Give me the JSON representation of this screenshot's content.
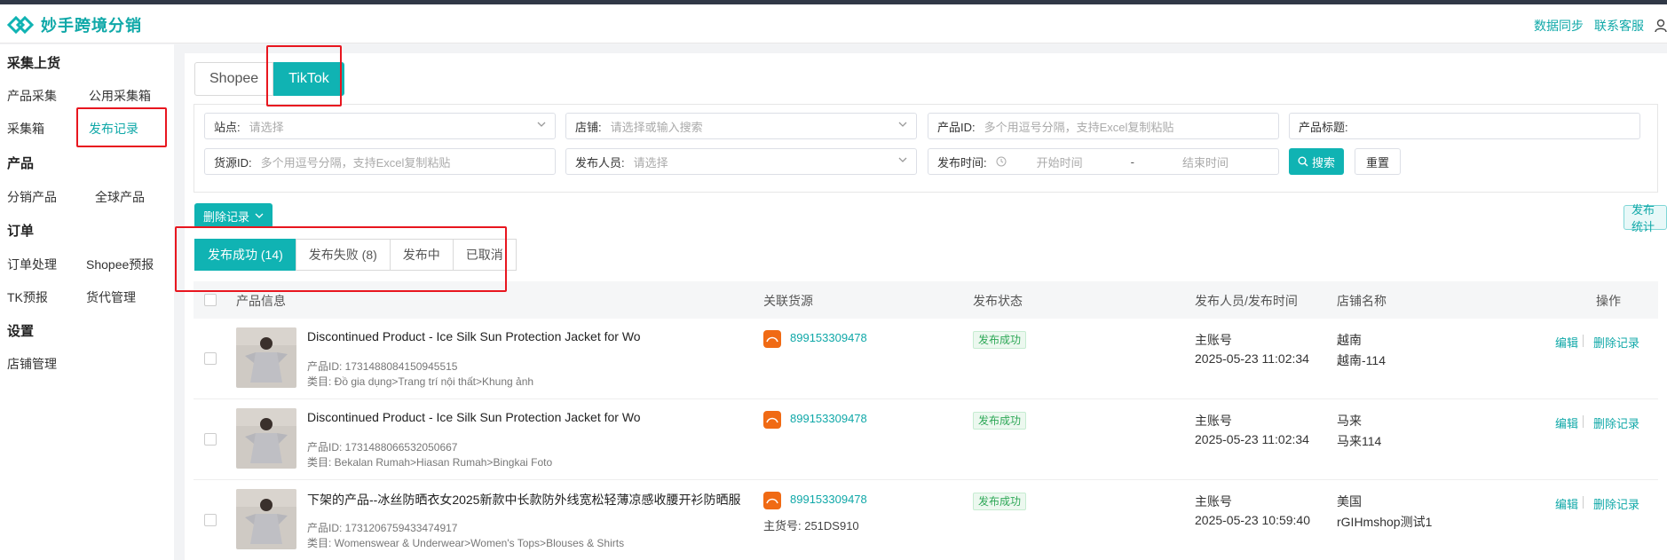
{
  "app": {
    "title": "妙手跨境分销"
  },
  "header": {
    "links": [
      "数据同步",
      "联系客服"
    ]
  },
  "sidebar": {
    "groups": [
      {
        "title": "采集上货",
        "items": [
          "产品采集",
          "公用采集箱",
          "采集箱",
          "发布记录"
        ]
      },
      {
        "title": "产品",
        "items": [
          "分销产品",
          "全球产品"
        ]
      },
      {
        "title": "订单",
        "items": [
          "订单处理",
          "Shopee预报",
          "TK预报",
          "货代管理"
        ]
      },
      {
        "title": "设置",
        "items": [
          "店铺管理"
        ]
      }
    ]
  },
  "platform_tabs": [
    "Shopee",
    "TikTok"
  ],
  "filters": {
    "site": {
      "label": "站点:",
      "placeholder": "请选择"
    },
    "store": {
      "label": "店铺:",
      "placeholder": "请选择或输入搜索"
    },
    "product_id": {
      "label": "产品ID:",
      "placeholder": "多个用逗号分隔，支持Excel复制粘贴"
    },
    "product_title": {
      "label": "产品标题:",
      "placeholder": ""
    },
    "source_id": {
      "label": "货源ID:",
      "placeholder": "多个用逗号分隔，支持Excel复制粘贴"
    },
    "publisher": {
      "label": "发布人员:",
      "placeholder": "请选择"
    },
    "publish_time": {
      "label": "发布时间:",
      "start": "开始时间",
      "sep": "-",
      "end": "结束时间"
    },
    "search_label": "搜索",
    "reset_label": "重置"
  },
  "toolbar": {
    "delete_label": "删除记录",
    "stats_label": "发布统计"
  },
  "status_tabs": [
    "发布成功 (14)",
    "发布失败 (8)",
    "发布中",
    "已取消"
  ],
  "table": {
    "headers": [
      "产品信息",
      "关联货源",
      "发布状态",
      "发布人员/发布时间",
      "店铺名称",
      "操作"
    ],
    "rows": [
      {
        "title": "Discontinued Product - Ice Silk Sun Protection Jacket for Wo",
        "product_id": "产品ID: 1731488084150945515",
        "category": "类目: Đồ gia dụng>Trang trí nội thất>Khung ảnh",
        "source_id": "899153309478",
        "source_sku": "",
        "status": "发布成功",
        "publisher": "主账号",
        "time": "2025-05-23 11:02:34",
        "store_region": "越南",
        "store_name": "越南-114",
        "edit": "编辑",
        "delete": "删除记录"
      },
      {
        "title": "Discontinued Product - Ice Silk Sun Protection Jacket for Wo",
        "product_id": "产品ID: 1731488066532050667",
        "category": "类目: Bekalan Rumah>Hiasan Rumah>Bingkai Foto",
        "source_id": "899153309478",
        "source_sku": "",
        "status": "发布成功",
        "publisher": "主账号",
        "time": "2025-05-23 11:02:34",
        "store_region": "马来",
        "store_name": "马来114",
        "edit": "编辑",
        "delete": "删除记录"
      },
      {
        "title": "下架的产品--冰丝防晒衣女2025新款中长款防外线宽松轻薄凉感收腰开衫防晒服",
        "product_id": "产品ID: 1731206759433474917",
        "category": "类目: Womenswear & Underwear>Women's Tops>Blouses & Shirts",
        "source_id": "899153309478",
        "source_sku": "主货号: 251DS910",
        "status": "发布成功",
        "publisher": "主账号",
        "time": "2025-05-23 10:59:40",
        "store_region": "美国",
        "store_name": "rGIHmshop测试1",
        "edit": "编辑",
        "delete": "删除记录"
      }
    ]
  },
  "colors": {
    "accent": "#10b3b3",
    "highlight": "#e8161f",
    "source_icon": "#f06a14"
  },
  "icons": [
    "logo-icon",
    "user-icon",
    "chevron-down-icon",
    "clock-icon",
    "search-icon",
    "source-1688-icon"
  ]
}
